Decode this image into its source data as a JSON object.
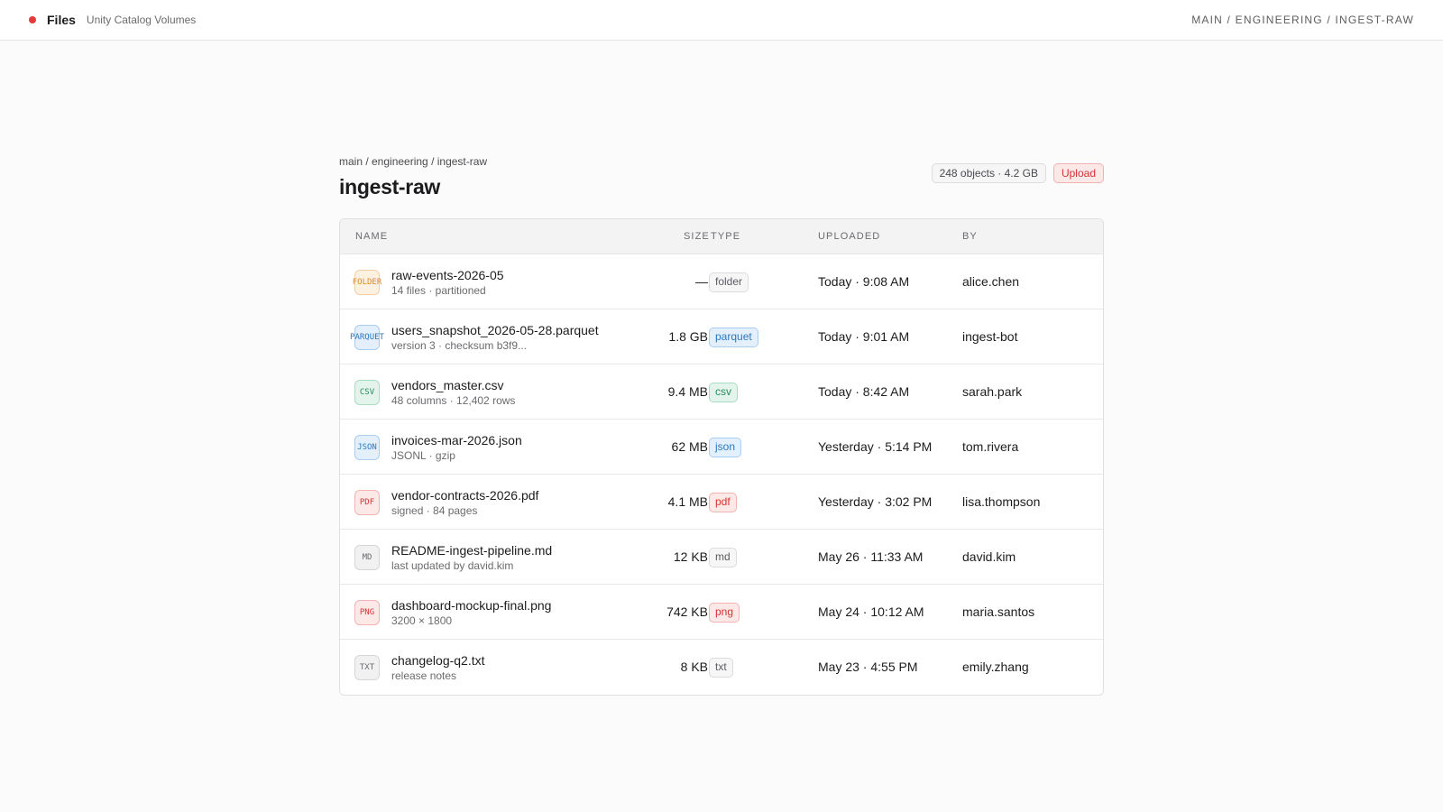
{
  "header": {
    "app_title": "Files",
    "app_subtitle": "Unity Catalog Volumes",
    "path": "MAIN / ENGINEERING / INGEST-RAW"
  },
  "page": {
    "breadcrumb": "main / engineering / ingest-raw",
    "title": "ingest-raw",
    "stats": "248 objects · 4.2 GB",
    "upload_label": "Upload"
  },
  "table": {
    "columns": {
      "name": "NAME",
      "size": "SIZE",
      "type": "TYPE",
      "uploaded": "UPLOADED",
      "by": "BY"
    },
    "rows": [
      {
        "icon": "FOLDER",
        "kind": "folder",
        "name": "raw-events-2026-05",
        "meta": "14 files · partitioned",
        "size": "—",
        "type": "folder",
        "uploaded": "Today · 9:08 AM",
        "by": "alice.chen"
      },
      {
        "icon": "PARQUET",
        "kind": "parquet",
        "name": "users_snapshot_2026-05-28.parquet",
        "meta": "version 3 · checksum b3f9...",
        "size": "1.8 GB",
        "type": "parquet",
        "uploaded": "Today · 9:01 AM",
        "by": "ingest-bot"
      },
      {
        "icon": "CSV",
        "kind": "csv",
        "name": "vendors_master.csv",
        "meta": "48 columns · 12,402 rows",
        "size": "9.4 MB",
        "type": "csv",
        "uploaded": "Today · 8:42 AM",
        "by": "sarah.park"
      },
      {
        "icon": "JSON",
        "kind": "json",
        "name": "invoices-mar-2026.json",
        "meta": "JSONL · gzip",
        "size": "62 MB",
        "type": "json",
        "uploaded": "Yesterday · 5:14 PM",
        "by": "tom.rivera"
      },
      {
        "icon": "PDF",
        "kind": "pdf",
        "name": "vendor-contracts-2026.pdf",
        "meta": "signed · 84 pages",
        "size": "4.1 MB",
        "type": "pdf",
        "uploaded": "Yesterday · 3:02 PM",
        "by": "lisa.thompson"
      },
      {
        "icon": "MD",
        "kind": "md",
        "name": "README-ingest-pipeline.md",
        "meta": "last updated by david.kim",
        "size": "12 KB",
        "type": "md",
        "uploaded": "May 26 · 11:33 AM",
        "by": "david.kim"
      },
      {
        "icon": "PNG",
        "kind": "png",
        "name": "dashboard-mockup-final.png",
        "meta": "3200 × 1800",
        "size": "742 KB",
        "type": "png",
        "uploaded": "May 24 · 10:12 AM",
        "by": "maria.santos"
      },
      {
        "icon": "TXT",
        "kind": "txt",
        "name": "changelog-q2.txt",
        "meta": "release notes",
        "size": "8 KB",
        "type": "txt",
        "uploaded": "May 23 · 4:55 PM",
        "by": "emily.zhang"
      }
    ]
  }
}
